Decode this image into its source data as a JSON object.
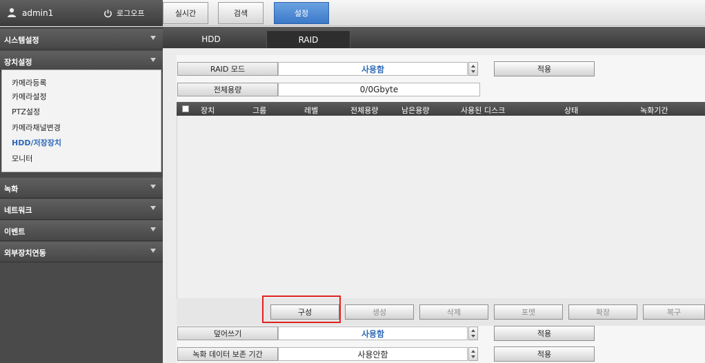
{
  "header": {
    "user_name": "admin1",
    "logout_label": "로그오프",
    "tabs": [
      {
        "label": "실시간"
      },
      {
        "label": "검색"
      },
      {
        "label": "설정"
      }
    ]
  },
  "sidebar": {
    "menus": [
      {
        "label": "시스템설정"
      },
      {
        "label": "장치설정"
      },
      {
        "label": "녹화"
      },
      {
        "label": "네트워크"
      },
      {
        "label": "이벤트"
      },
      {
        "label": "외부장치연동"
      }
    ],
    "submenu": [
      {
        "label": "카메라등록"
      },
      {
        "label": "카메라설정"
      },
      {
        "label": "PTZ설정"
      },
      {
        "label": "카메라채널변경"
      },
      {
        "label": "HDD/저장장치"
      },
      {
        "label": "모니터"
      }
    ]
  },
  "subtabs": [
    {
      "label": "HDD"
    },
    {
      "label": "RAID"
    }
  ],
  "raid_mode": {
    "label": "RAID 모드",
    "value": "사용함",
    "apply_label": "적용"
  },
  "total_capacity": {
    "label": "전체용량",
    "value": "0/0Gbyte"
  },
  "table": {
    "columns": [
      "장치",
      "그룹",
      "레벨",
      "전체용량",
      "남은용량",
      "사용된 디스크",
      "상태",
      "녹화기간"
    ]
  },
  "action_buttons": [
    {
      "label": "구성"
    },
    {
      "label": "생성"
    },
    {
      "label": "삭제"
    },
    {
      "label": "포맷"
    },
    {
      "label": "확장"
    },
    {
      "label": "복구"
    }
  ],
  "overwrite": {
    "label": "덮어쓰기",
    "value": "사용함",
    "apply_label": "적용"
  },
  "retention": {
    "label": "녹화 데이터 보존 기간",
    "value": "사용안함",
    "apply_label": "적용"
  },
  "colors": {
    "accent_blue": "#2c68b8",
    "active_tab": "#3a78c8",
    "highlight_red": "#e02020"
  },
  "icons": {
    "user": "user-icon",
    "logout": "power-icon",
    "caret": "caret-down-icon",
    "spinner": "spinner-arrows-icon"
  }
}
